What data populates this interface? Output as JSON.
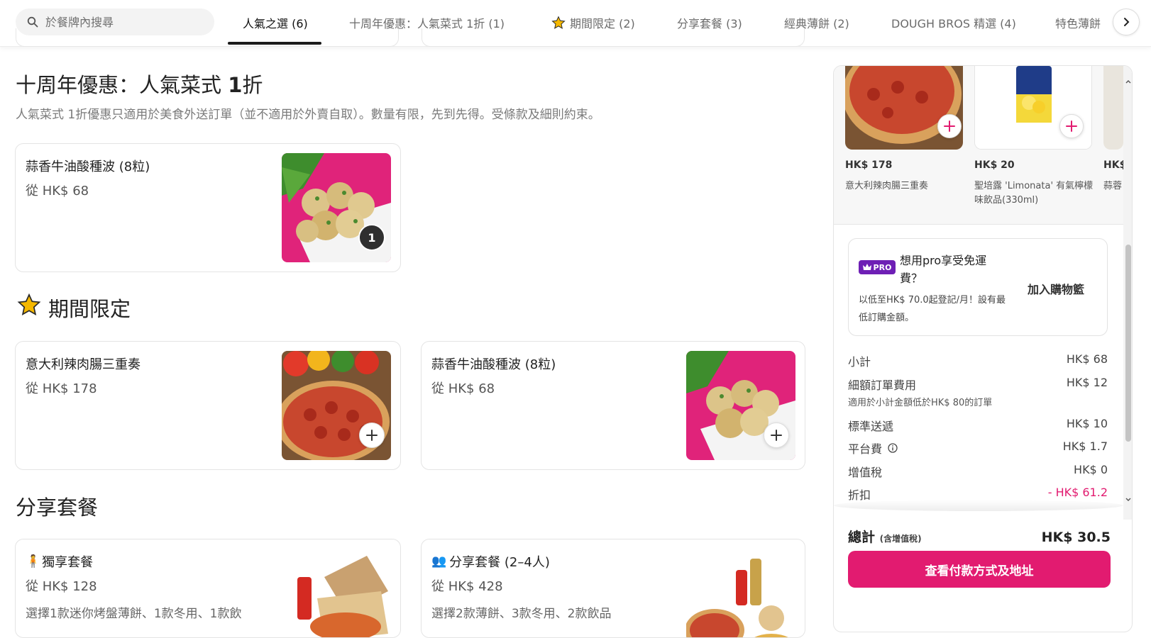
{
  "search": {
    "placeholder": "於餐牌內搜尋"
  },
  "tabs": [
    {
      "label": "人氣之選 (6)"
    },
    {
      "label": "十周年優惠：人氣菜式 1折 (1)"
    },
    {
      "label": "期間限定 (2)"
    },
    {
      "label": "分享套餐 (3)"
    },
    {
      "label": "經典薄餅 (2)"
    },
    {
      "label": "DOUGH BROS 精選 (4)"
    },
    {
      "label": "特色薄餅"
    }
  ],
  "sections": {
    "anniversary": {
      "title_pre": "十周年優惠：人氣菜式 ",
      "title_bold": "1",
      "title_post": "折",
      "desc": "人氣菜式 1折優惠只適用於美食外送訂單（並不適用於外賣自取）。數量有限，先到先得。受條款及細則約束。",
      "items": [
        {
          "name": "蒜香牛油酸種波 (8粒)",
          "price": "從 HK$ 68",
          "qty": "1"
        }
      ]
    },
    "limited": {
      "title": "期間限定",
      "items": [
        {
          "name": "意大利辣肉腸三重奏",
          "price": "從 HK$ 178"
        },
        {
          "name": "蒜香牛油酸種波 (8粒)",
          "price": "從 HK$ 68"
        }
      ]
    },
    "sharing": {
      "title": "分享套餐",
      "items": [
        {
          "name": "獨享套餐",
          "price": "從 HK$ 128",
          "desc": "選擇1款迷你烤盤薄餅、1款冬用、1款飲"
        },
        {
          "name": "分享套餐 (2–4人)",
          "price": "從 HK$ 428",
          "desc": "選擇2款薄餅、3款冬用、2款飲品"
        }
      ]
    }
  },
  "cart": {
    "recommendations": [
      {
        "price": "HK$ 178",
        "name": "意大利辣肉腸三重奏"
      },
      {
        "price": "HK$ 20",
        "name": "聖培露 'Limonata' 有氣檸檬味飲品(330ml)"
      },
      {
        "price": "HK$",
        "name": "蒜蓉"
      }
    ],
    "pro": {
      "badge": "PRO",
      "title": "想用pro享受免運費？",
      "desc": "以低至HK$ 70.0起登記/月！設有最低訂購金額。",
      "add_label": "加入購物籃"
    },
    "lines": [
      {
        "label": "小計",
        "value": "HK$ 68"
      },
      {
        "label": "細額訂單費用",
        "value": "HK$ 12",
        "note": "適用於小計金額低於HK$ 80的訂單"
      },
      {
        "label": "標準送遞",
        "value": "HK$ 10"
      },
      {
        "label": "平台費",
        "value": "HK$ 1.7"
      },
      {
        "label": "增值稅",
        "value": "HK$ 0"
      },
      {
        "label": "折扣",
        "value": "- HK$ 61.2"
      }
    ],
    "total_label": "總計",
    "total_note": "(含增值稅)",
    "total_value": "HK$ 30.5",
    "checkout_label": "查看付款方式及地址"
  },
  "colors": {
    "accent": "#e21b70",
    "pro": "#6e1fb5"
  }
}
